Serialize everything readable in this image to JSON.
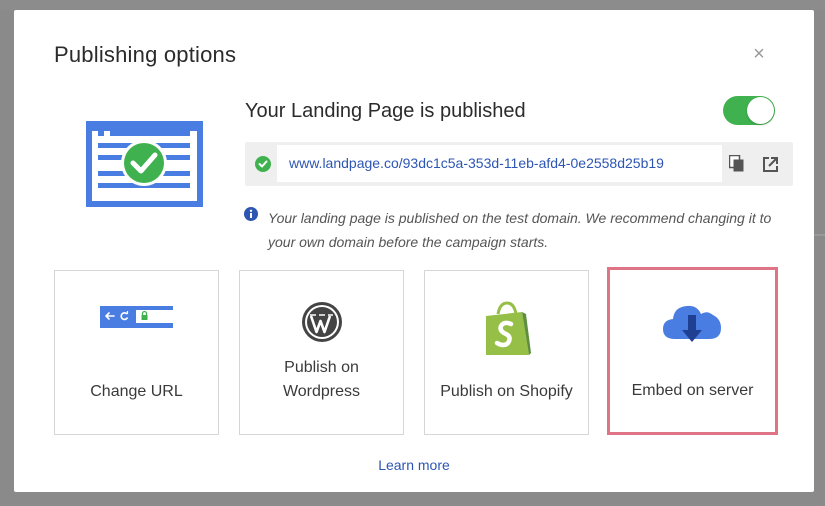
{
  "modal": {
    "title": "Publishing options",
    "close_icon": "close-icon"
  },
  "status": {
    "heading": "Your Landing Page is published",
    "published": true
  },
  "url": {
    "value": "www.landpage.co/93dc1c5a-353d-11eb-afd4-0e2558d25b19"
  },
  "info": {
    "text": "Your landing page is published on the test domain. We recommend changing it to your own domain before the campaign starts."
  },
  "cards": [
    {
      "label": "Change URL",
      "icon": "browser-url-icon"
    },
    {
      "label": "Publish on Wordpress",
      "icon": "wordpress-icon"
    },
    {
      "label": "Publish on Shopify",
      "icon": "shopify-icon"
    },
    {
      "label": "Embed on server",
      "icon": "cloud-download-icon",
      "selected": true
    }
  ],
  "footer": {
    "learn_more": "Learn more"
  },
  "colors": {
    "accent_blue": "#4a7de2",
    "success_green": "#3fb24f",
    "link_blue": "#2d56b3",
    "selected_border": "#e07487",
    "shopify_green": "#95bf47"
  }
}
